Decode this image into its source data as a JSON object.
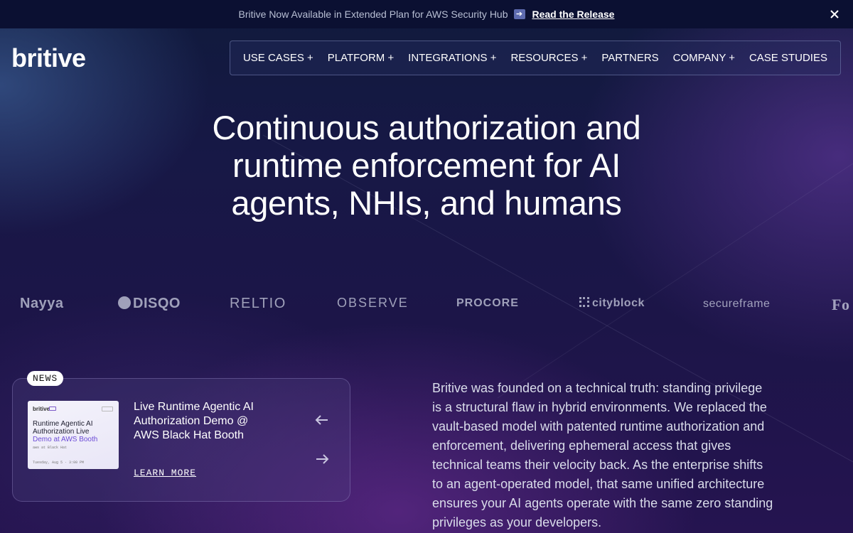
{
  "banner": {
    "text": "Britive Now Available in Extended Plan for AWS Security Hub",
    "arrow_icon": "right-arrow-icon",
    "link": "Read the Release"
  },
  "logo": {
    "text": "britive"
  },
  "nav": {
    "items": [
      {
        "label": "USE CASES +"
      },
      {
        "label": "PLATFORM +"
      },
      {
        "label": "INTEGRATIONS +"
      },
      {
        "label": "RESOURCES +"
      },
      {
        "label": "PARTNERS"
      },
      {
        "label": "COMPANY +"
      },
      {
        "label": "CASE STUDIES"
      }
    ]
  },
  "hero": {
    "headline": "Continuous authorization and runtime enforcement for AI agents, NHIs, and humans"
  },
  "customers": {
    "logos": [
      "Nayya",
      "DISQO",
      "RELTIO",
      "OBSERVE",
      "PROCORE",
      "cityblock",
      "secureframe",
      "Fo"
    ]
  },
  "news": {
    "badge": "NEWS",
    "thumb": {
      "logo": "britive",
      "line1": "Runtime Agentic AI",
      "line2": "Authorization Live",
      "line3": "Demo at AWS Booth",
      "meta1": "aws at Black Hat",
      "meta2": "Tuesday, Aug 5 · 3:00 PM"
    },
    "title": "Live Runtime Agentic AI Authorization Demo @ AWS Black Hat Booth",
    "link": "LEARN MORE"
  },
  "about": {
    "text": "Britive was founded on a technical truth: standing privilege is a structural flaw in hybrid environments. We replaced the vault-based model with patented runtime authorization and enforcement, delivering ephemeral access that gives technical teams their velocity back. As the enterprise shifts to an agent-operated model, that same unified architecture ensures your AI agents operate with the same zero standing privileges as your developers."
  }
}
